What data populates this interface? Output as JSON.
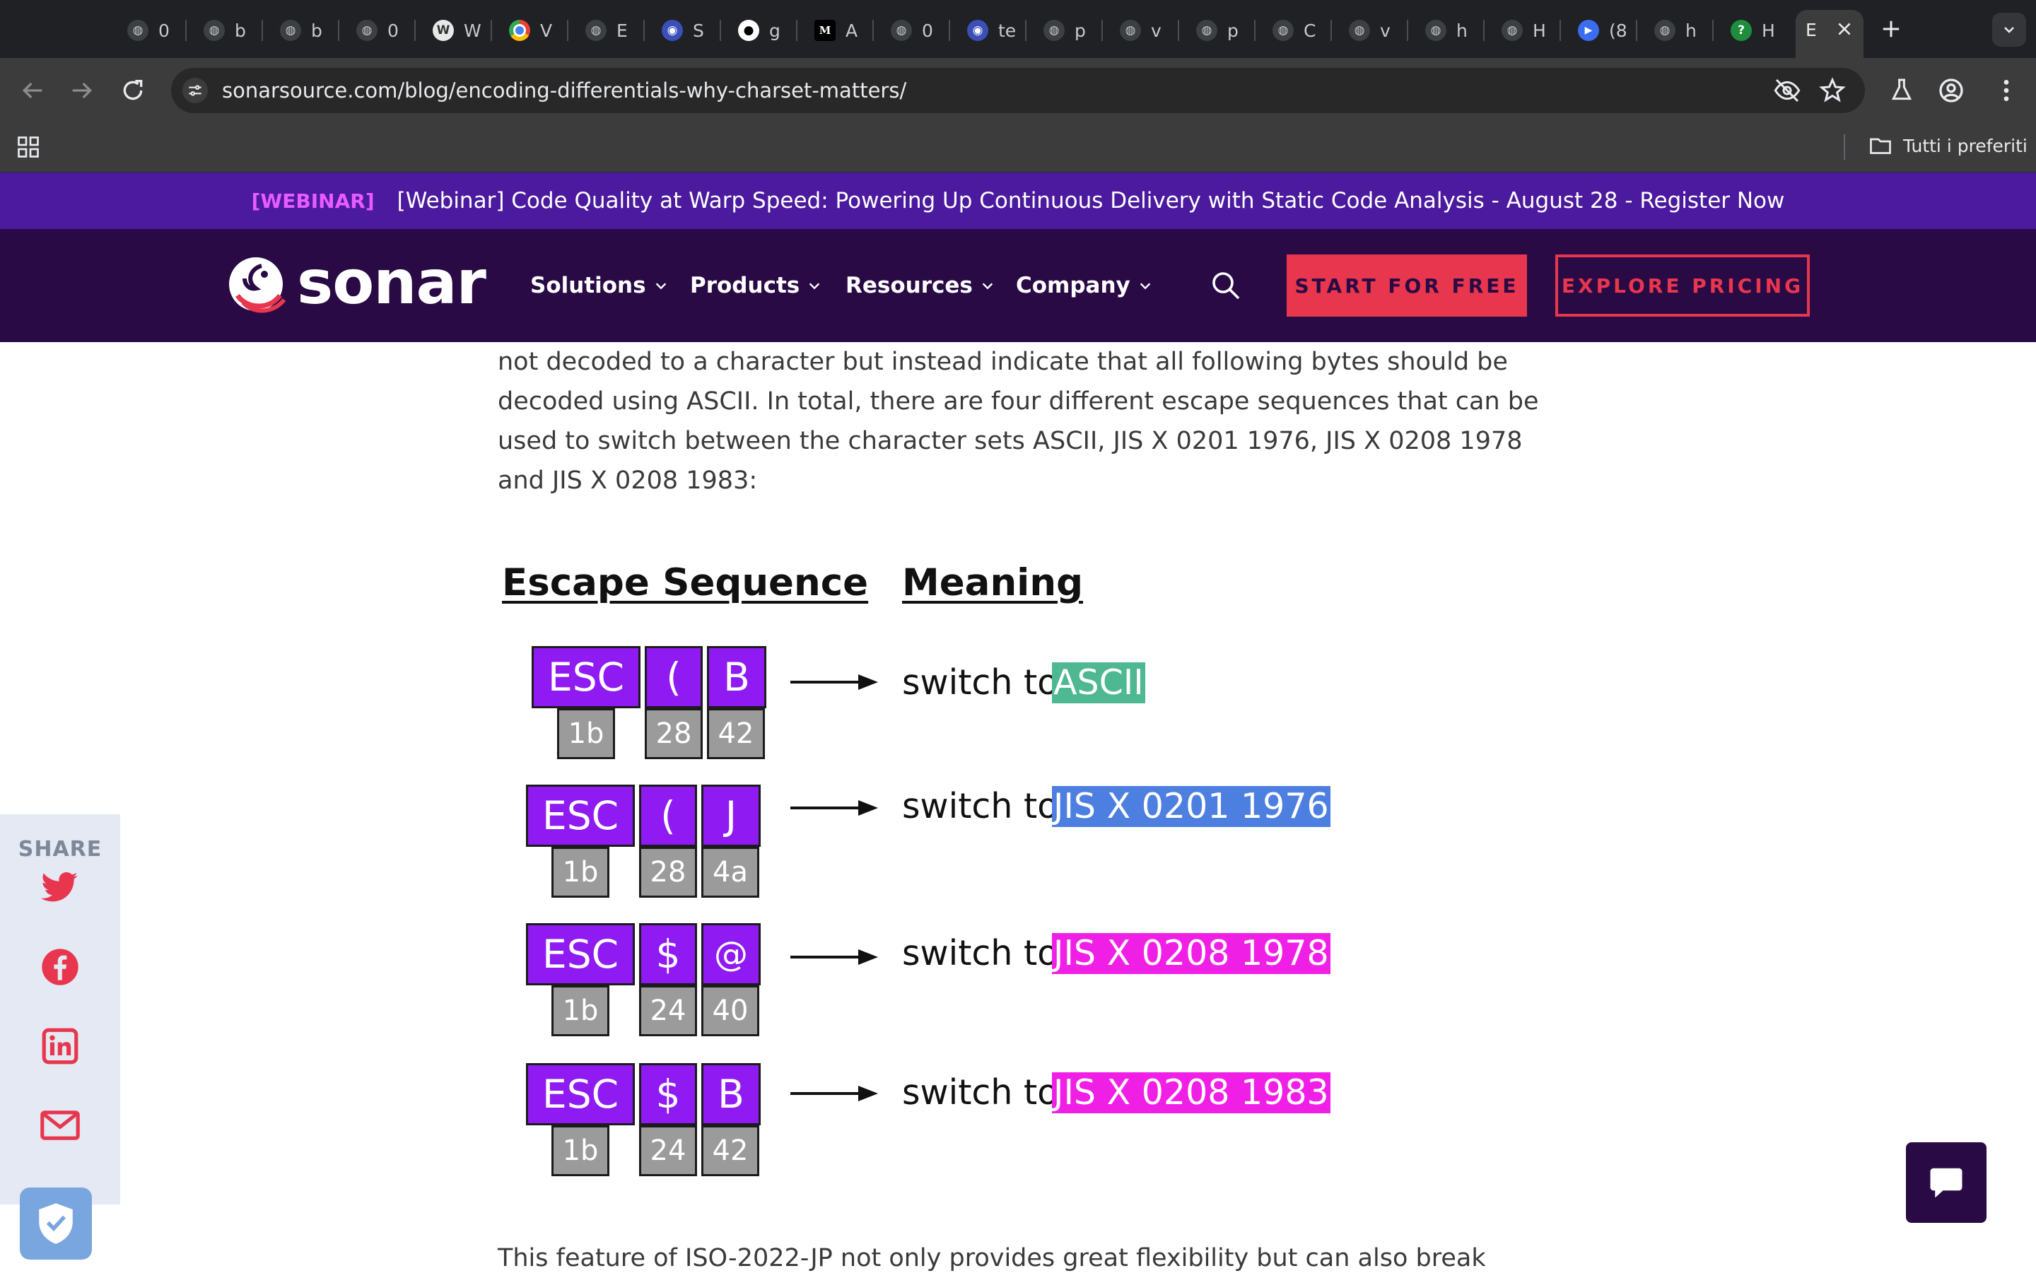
{
  "browser": {
    "tabs": [
      {
        "title": "0",
        "icon": "globe-icon"
      },
      {
        "title": "b",
        "icon": "globe-icon"
      },
      {
        "title": "b",
        "icon": "globe-icon"
      },
      {
        "title": "0",
        "icon": "globe-icon"
      },
      {
        "title": "W",
        "icon": "globe-icon"
      },
      {
        "title": "V",
        "icon": "chrome-icon"
      },
      {
        "title": "E",
        "icon": "globe-icon"
      },
      {
        "title": "S",
        "icon": "shield-icon"
      },
      {
        "title": "g",
        "icon": "github-icon"
      },
      {
        "title": "A",
        "icon": "medium-icon"
      },
      {
        "title": "0",
        "icon": "globe-icon"
      },
      {
        "title": "te",
        "icon": "shield-icon"
      },
      {
        "title": "p",
        "icon": "globe-icon"
      },
      {
        "title": "v",
        "icon": "globe-icon"
      },
      {
        "title": "p",
        "icon": "globe-icon"
      },
      {
        "title": "C",
        "icon": "globe-icon"
      },
      {
        "title": "v",
        "icon": "globe-icon"
      },
      {
        "title": "h",
        "icon": "globe-icon"
      },
      {
        "title": "H",
        "icon": "globe-icon"
      },
      {
        "title": "(8",
        "icon": "play-icon"
      },
      {
        "title": "h",
        "icon": "globe-icon"
      },
      {
        "title": "H",
        "icon": "help-icon"
      }
    ],
    "active_tab": {
      "title": "E"
    },
    "url": "sonarsource.com/blog/encoding-differentials-why-charset-matters/",
    "bookmarks_folder": "Tutti i preferiti"
  },
  "banner": {
    "tag": "[WEBINAR]",
    "text": "[Webinar] Code Quality at Warp Speed: Powering Up Continuous Delivery with Static Code Analysis - August 28 - Register Now"
  },
  "header": {
    "logo": "sonar",
    "nav": [
      "Solutions",
      "Products",
      "Resources",
      "Company"
    ],
    "cta_primary": "START FOR FREE",
    "cta_secondary": "EXPLORE PRICING"
  },
  "article": {
    "para1": "not decoded to a character but instead indicate that all following bytes should be decoded using ASCII. In total, there are four different escape sequences that can be used to switch between the character sets ASCII, JIS X 0201 1976, JIS X 0208 1978 and JIS X 0208 1983:",
    "figure": {
      "col1": "Escape Sequence",
      "col2": "Meaning",
      "switch_label": "switch to",
      "rows": [
        {
          "chars": [
            "ESC",
            "(",
            "B"
          ],
          "hex": [
            "1b",
            "28",
            "42"
          ],
          "charset": "ASCII",
          "color": "#4db891"
        },
        {
          "chars": [
            "ESC",
            "(",
            "J"
          ],
          "hex": [
            "1b",
            "28",
            "4a"
          ],
          "charset": "JIS X 0201 1976",
          "color": "#4c7fe0"
        },
        {
          "chars": [
            "ESC",
            "$",
            "@"
          ],
          "hex": [
            "1b",
            "24",
            "40"
          ],
          "charset": "JIS X 0208 1978",
          "color": "#f01fe6"
        },
        {
          "chars": [
            "ESC",
            "$",
            "B"
          ],
          "hex": [
            "1b",
            "24",
            "42"
          ],
          "charset": "JIS X 0208 1983",
          "color": "#f01fe6"
        }
      ]
    },
    "para2": "This feature of ISO-2022-JP not only provides great flexibility but can also break"
  },
  "share": {
    "label": "SHARE",
    "items": [
      "twitter-icon",
      "facebook-icon",
      "linkedin-icon",
      "email-icon"
    ]
  },
  "colors": {
    "brand_dark": "#290a45",
    "brand_red": "#e7364d",
    "banner": "#4b1a9e",
    "purple_box": "#8f1bf2"
  }
}
